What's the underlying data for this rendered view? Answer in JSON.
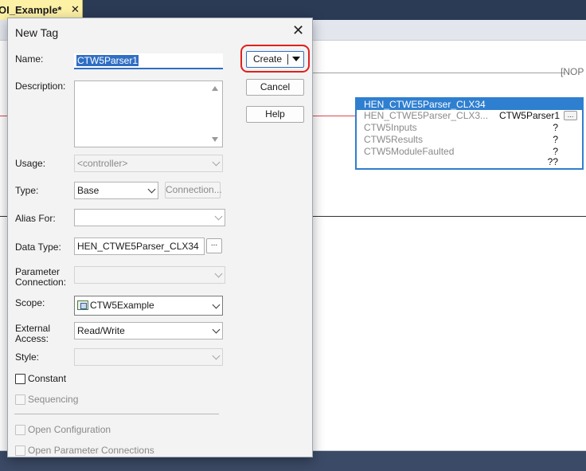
{
  "app": {
    "tab_title": "OI_Example*",
    "tab_close": "✕",
    "nop_label": "NOP",
    "function_block": {
      "title": "HEN_CTWE5Parser_CLX34",
      "rows": [
        {
          "label": "HEN_CTWE5Parser_CLX3...",
          "value": "CTW5Parser1",
          "has_button": true,
          "button": "..."
        },
        {
          "label": "CTW5Inputs",
          "value": "?"
        },
        {
          "label": "CTW5Results",
          "value": "?"
        },
        {
          "label": "CTW5ModuleFaulted",
          "value": "?"
        }
      ],
      "footer_value": "??"
    }
  },
  "dialog": {
    "title": "New Tag",
    "close": "✕",
    "name": {
      "label": "Name:",
      "value": "CTW5Parser1"
    },
    "description": {
      "label": "Description:",
      "value": ""
    },
    "usage": {
      "label": "Usage:",
      "value": "<controller>"
    },
    "type": {
      "label": "Type:",
      "value": "Base",
      "connection_button": "Connection..."
    },
    "alias_for": {
      "label": "Alias For:",
      "value": ""
    },
    "data_type": {
      "label": "Data Type:",
      "value": "HEN_CTWE5Parser_CLX34",
      "browse_button": "..."
    },
    "parameter_connection": {
      "label_line1": "Parameter",
      "label_line2": "Connection:",
      "value": ""
    },
    "scope": {
      "label": "Scope:",
      "value": "CTW5Example",
      "icon": "controller-icon"
    },
    "external_access": {
      "label_line1": "External",
      "label_line2": "Access:",
      "value": "Read/Write"
    },
    "style": {
      "label": "Style:",
      "value": ""
    },
    "checkboxes": {
      "constant": {
        "label": "Constant",
        "checked": false,
        "enabled": true
      },
      "sequencing": {
        "label": "Sequencing",
        "checked": false,
        "enabled": false
      },
      "open_configuration": {
        "label": "Open Configuration",
        "checked": false,
        "enabled": false
      },
      "open_parameter_connections": {
        "label": "Open Parameter Connections",
        "checked": false,
        "enabled": false
      }
    },
    "buttons": {
      "create": "Create",
      "cancel": "Cancel",
      "help": "Help"
    },
    "highlight_color": "#e0201c",
    "accent_color": "#2f6ec4"
  }
}
